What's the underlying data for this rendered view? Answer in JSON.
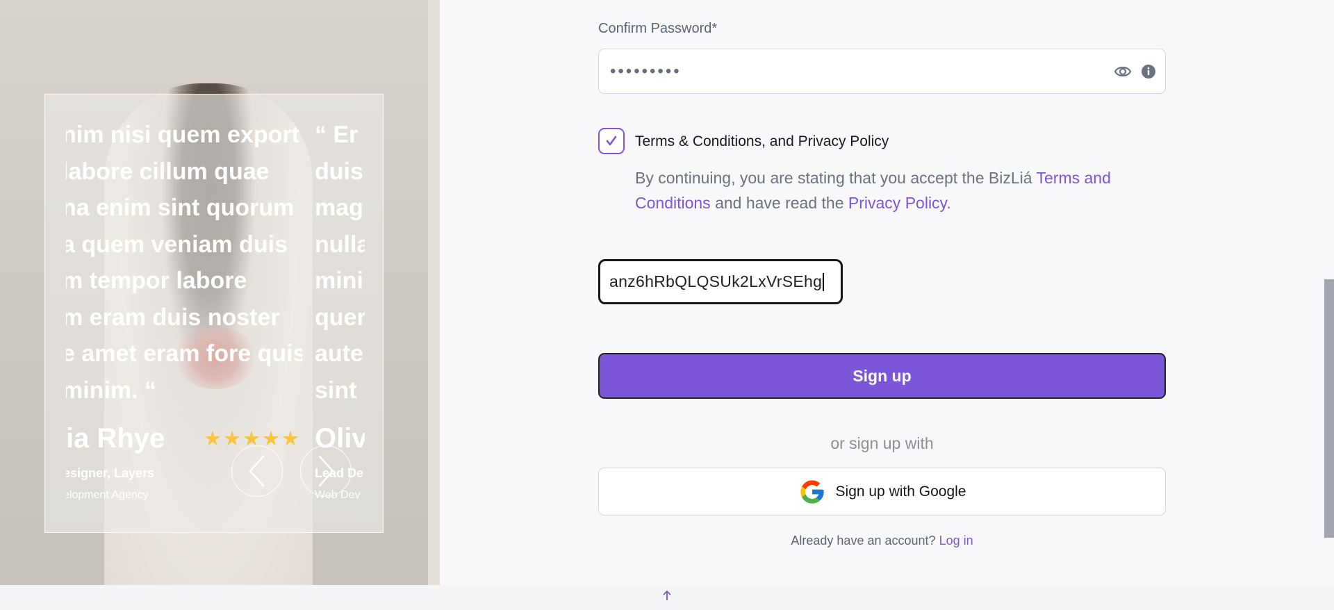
{
  "testimonial": {
    "quote_current_lines": [
      "nim nisi quem export",
      " labore cillum quae",
      "na enim sint quorum",
      "a quem veniam duis",
      "m tempor labore",
      "m eram duis noster",
      "e amet eram fore quis",
      "minim. “"
    ],
    "quote_next_lines": [
      "“ Er",
      "duis",
      "mag",
      "nulla",
      "mini",
      "quer",
      "aute",
      "sint"
    ],
    "current_name": "ia Rhye",
    "current_role": "esigner, Layers",
    "current_org": "elopment Agency",
    "next_name": "Oliv",
    "next_role": "Lead De",
    "next_org": "Web Dev",
    "stars": "★★★★★",
    "rating": 5,
    "star_color": "#f7c43e"
  },
  "form": {
    "confirm_password_label": "Confirm Password*",
    "confirm_password_value": "•••••••••",
    "terms_checked": true,
    "terms_title": "Terms & Conditions, and Privacy Policy",
    "terms_prefix": "By continuing, you are stating that you accept the BizLiá ",
    "terms_link": "Terms and Conditions",
    "terms_middle": " and have read the ",
    "privacy_link": "Privacy Policy",
    "terms_suffix": ".",
    "captcha_value": "anz6hRbQLQSUk2LxVrSEhg",
    "signup_label": "Sign up",
    "or_label": "or sign up with",
    "google_label": "Sign up with Google",
    "login_prompt": "Already have an account?",
    "login_link": "Log in"
  },
  "colors": {
    "accent": "#7b56d9",
    "text_muted": "#6b7280",
    "border": "#d6d8e0"
  },
  "icons": [
    "eye-icon",
    "info-icon",
    "check-icon",
    "google-icon",
    "chevron-left-icon",
    "chevron-right-icon",
    "arrow-up-icon"
  ]
}
